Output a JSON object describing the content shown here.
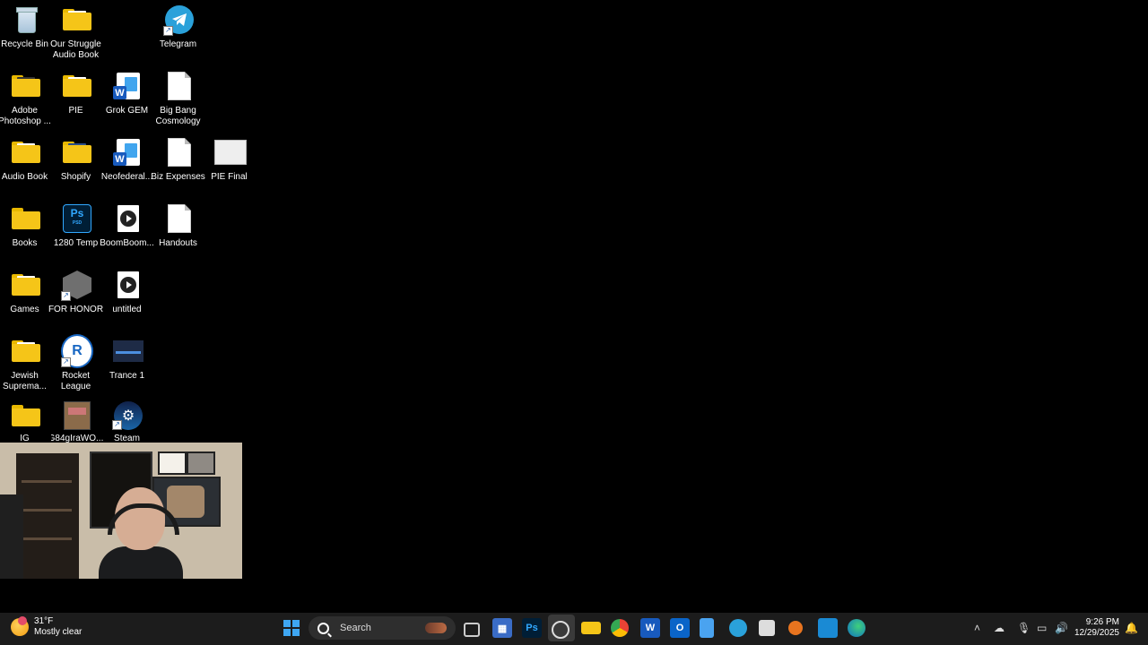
{
  "desktop": {
    "icons": [
      {
        "label": "Recycle Bin",
        "icon": "recycle-bin-icon"
      },
      {
        "label": "Our Struggle Audio Book",
        "icon": "folder-icon"
      },
      {
        "label": "Telegram",
        "icon": "telegram-icon"
      },
      {
        "label": "Adobe Photoshop ...",
        "icon": "folder-icon"
      },
      {
        "label": "PIE",
        "icon": "folder-icon"
      },
      {
        "label": "Grok GEM",
        "icon": "word-doc-icon"
      },
      {
        "label": "Big Bang Cosmology",
        "icon": "text-doc-icon"
      },
      {
        "label": "Audio Book",
        "icon": "folder-icon"
      },
      {
        "label": "Shopify",
        "icon": "folder-icon"
      },
      {
        "label": "Neofederal...",
        "icon": "word-doc-icon"
      },
      {
        "label": "Biz Expenses",
        "icon": "text-doc-icon"
      },
      {
        "label": "PIE Final",
        "icon": "image-thumbnail-icon"
      },
      {
        "label": "Books",
        "icon": "folder-icon"
      },
      {
        "label": "1280 Temp",
        "icon": "psd-file-icon"
      },
      {
        "label": "BoomBoom...",
        "icon": "media-file-icon"
      },
      {
        "label": "Handouts",
        "icon": "text-doc-icon"
      },
      {
        "label": "Games",
        "icon": "folder-icon"
      },
      {
        "label": "FOR HONOR",
        "icon": "for-honor-icon"
      },
      {
        "label": "untitled",
        "icon": "media-file-icon"
      },
      {
        "label": "Jewish Suprema...",
        "icon": "folder-icon"
      },
      {
        "label": "Rocket League",
        "icon": "rocket-league-icon"
      },
      {
        "label": "Trance 1",
        "icon": "image-thumbnail-icon"
      },
      {
        "label": "IG",
        "icon": "folder-icon"
      },
      {
        "label": "G84gIraWO...",
        "icon": "image-thumbnail-icon"
      },
      {
        "label": "Steam",
        "icon": "steam-icon"
      }
    ]
  },
  "taskbar": {
    "weather": {
      "temp": "31°F",
      "condition": "Mostly clear"
    },
    "search_label": "Search",
    "apps": [
      "file-explorer-icon",
      "calculator-icon",
      "photoshop-icon",
      "obs-icon",
      "folder-icon",
      "chrome-icon",
      "word-icon",
      "outlook-icon",
      "notepad-icon",
      "telegram-icon",
      "snipping-tool-icon",
      "media-icon",
      "store-icon",
      "edge-icon"
    ],
    "clock": {
      "time": "9:26 PM",
      "date": "12/29/2025"
    }
  },
  "colors": {
    "taskbar": "#1c1c1c",
    "desktop": "#000000",
    "accent": "#3ea6f2",
    "folder": "#f5c518"
  }
}
